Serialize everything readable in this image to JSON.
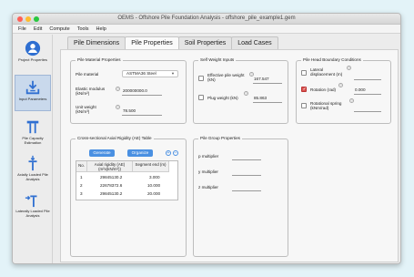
{
  "window": {
    "title": "OEMS - Offshore Pile Foundation Analysis - offshore_pile_example1.gem"
  },
  "menu": [
    "File",
    "Edit",
    "Compute",
    "Tools",
    "Help"
  ],
  "sidebar": {
    "items": [
      {
        "label": "Project Properties",
        "icon": "person-icon"
      },
      {
        "label": "Input Parameters",
        "icon": "download-tray-icon"
      },
      {
        "label": "Pile Capacity Estimation",
        "icon": "pile-capacity-icon"
      },
      {
        "label": "Axially Loaded Pile Analysis",
        "icon": "axial-pile-icon"
      },
      {
        "label": "Laterally Loaded Pile Analysis",
        "icon": "lateral-pile-icon"
      }
    ]
  },
  "tabs": [
    "Pile Dimensions",
    "Pile Properties",
    "Soil Properties",
    "Load Cases"
  ],
  "material": {
    "title": "Pile Material Properties",
    "material_label": "Pile material",
    "material_value": "ASTMA36 Steel",
    "elastic_label": "Elastic modulus",
    "elastic_unit": "(kN/m²)",
    "elastic_value": "200000000.0",
    "unit_label": "Unit weight",
    "unit_unit": "(kN/m³)",
    "unit_value": "78.500"
  },
  "selfweight": {
    "title": "Self Weight Inputs",
    "effective_label": "Effective pile weight",
    "effective_unit": "(kN)",
    "effective_value": "167.547",
    "plug_label": "Plug weight (kN)",
    "plug_value": "85.863"
  },
  "boundary": {
    "title": "Pile Head Boundary Conditions",
    "lateral_label": "Lateral",
    "lateral_label2": "displacement (m)",
    "rotation_label": "Rotation (rad)",
    "rotation_value": "0.000",
    "spring_label": "Rotational spring",
    "spring_unit": "(kNm/rad)"
  },
  "ae_table": {
    "title": "Cross-sectional Axial Rigidity (AE) Table",
    "generate_label": "Generate",
    "organize_label": "Organize",
    "add_symbol": "+",
    "remove_symbol": "−",
    "columns": [
      "No.",
      "Axial rigidity (AE) (m²x(kN/m²))",
      "Segment end (m)"
    ],
    "rows": [
      [
        "1",
        "29845130.2",
        "3.000"
      ],
      [
        "2",
        "22678372.6",
        "10.000"
      ],
      [
        "3",
        "29845130.2",
        "20.000"
      ]
    ]
  },
  "group": {
    "title": "Pile Group Properties",
    "p_label": "p multiplier",
    "y_label": "y multiplier",
    "z_label": "z multiplier"
  },
  "info_symbol": "?",
  "colors": {
    "accent": "#4a90e2",
    "checked": "#d9534f",
    "active_side": "#c9d9ec"
  }
}
